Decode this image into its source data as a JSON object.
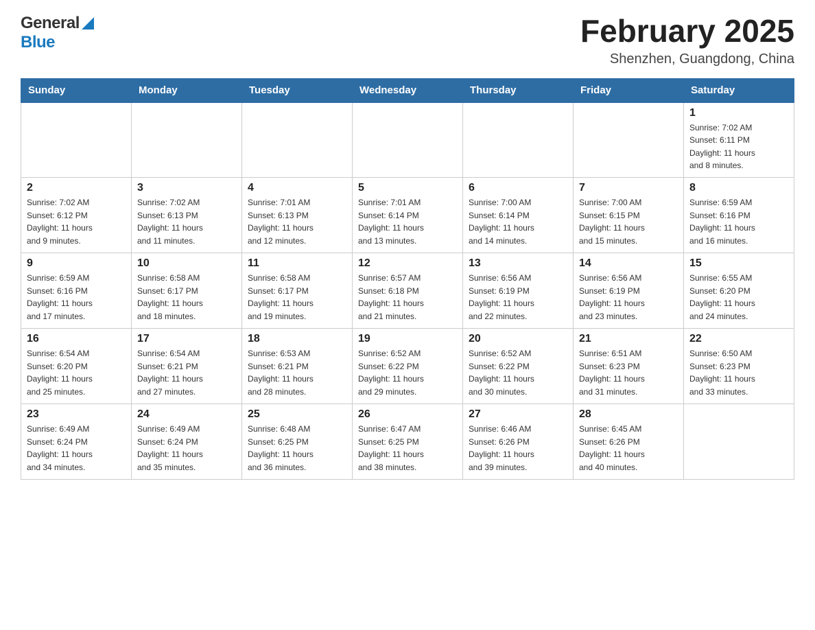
{
  "logo": {
    "general": "General",
    "blue": "Blue"
  },
  "header": {
    "month_year": "February 2025",
    "location": "Shenzhen, Guangdong, China"
  },
  "days_of_week": [
    "Sunday",
    "Monday",
    "Tuesday",
    "Wednesday",
    "Thursday",
    "Friday",
    "Saturday"
  ],
  "weeks": [
    [
      {
        "day": "",
        "info": ""
      },
      {
        "day": "",
        "info": ""
      },
      {
        "day": "",
        "info": ""
      },
      {
        "day": "",
        "info": ""
      },
      {
        "day": "",
        "info": ""
      },
      {
        "day": "",
        "info": ""
      },
      {
        "day": "1",
        "info": "Sunrise: 7:02 AM\nSunset: 6:11 PM\nDaylight: 11 hours\nand 8 minutes."
      }
    ],
    [
      {
        "day": "2",
        "info": "Sunrise: 7:02 AM\nSunset: 6:12 PM\nDaylight: 11 hours\nand 9 minutes."
      },
      {
        "day": "3",
        "info": "Sunrise: 7:02 AM\nSunset: 6:13 PM\nDaylight: 11 hours\nand 11 minutes."
      },
      {
        "day": "4",
        "info": "Sunrise: 7:01 AM\nSunset: 6:13 PM\nDaylight: 11 hours\nand 12 minutes."
      },
      {
        "day": "5",
        "info": "Sunrise: 7:01 AM\nSunset: 6:14 PM\nDaylight: 11 hours\nand 13 minutes."
      },
      {
        "day": "6",
        "info": "Sunrise: 7:00 AM\nSunset: 6:14 PM\nDaylight: 11 hours\nand 14 minutes."
      },
      {
        "day": "7",
        "info": "Sunrise: 7:00 AM\nSunset: 6:15 PM\nDaylight: 11 hours\nand 15 minutes."
      },
      {
        "day": "8",
        "info": "Sunrise: 6:59 AM\nSunset: 6:16 PM\nDaylight: 11 hours\nand 16 minutes."
      }
    ],
    [
      {
        "day": "9",
        "info": "Sunrise: 6:59 AM\nSunset: 6:16 PM\nDaylight: 11 hours\nand 17 minutes."
      },
      {
        "day": "10",
        "info": "Sunrise: 6:58 AM\nSunset: 6:17 PM\nDaylight: 11 hours\nand 18 minutes."
      },
      {
        "day": "11",
        "info": "Sunrise: 6:58 AM\nSunset: 6:17 PM\nDaylight: 11 hours\nand 19 minutes."
      },
      {
        "day": "12",
        "info": "Sunrise: 6:57 AM\nSunset: 6:18 PM\nDaylight: 11 hours\nand 21 minutes."
      },
      {
        "day": "13",
        "info": "Sunrise: 6:56 AM\nSunset: 6:19 PM\nDaylight: 11 hours\nand 22 minutes."
      },
      {
        "day": "14",
        "info": "Sunrise: 6:56 AM\nSunset: 6:19 PM\nDaylight: 11 hours\nand 23 minutes."
      },
      {
        "day": "15",
        "info": "Sunrise: 6:55 AM\nSunset: 6:20 PM\nDaylight: 11 hours\nand 24 minutes."
      }
    ],
    [
      {
        "day": "16",
        "info": "Sunrise: 6:54 AM\nSunset: 6:20 PM\nDaylight: 11 hours\nand 25 minutes."
      },
      {
        "day": "17",
        "info": "Sunrise: 6:54 AM\nSunset: 6:21 PM\nDaylight: 11 hours\nand 27 minutes."
      },
      {
        "day": "18",
        "info": "Sunrise: 6:53 AM\nSunset: 6:21 PM\nDaylight: 11 hours\nand 28 minutes."
      },
      {
        "day": "19",
        "info": "Sunrise: 6:52 AM\nSunset: 6:22 PM\nDaylight: 11 hours\nand 29 minutes."
      },
      {
        "day": "20",
        "info": "Sunrise: 6:52 AM\nSunset: 6:22 PM\nDaylight: 11 hours\nand 30 minutes."
      },
      {
        "day": "21",
        "info": "Sunrise: 6:51 AM\nSunset: 6:23 PM\nDaylight: 11 hours\nand 31 minutes."
      },
      {
        "day": "22",
        "info": "Sunrise: 6:50 AM\nSunset: 6:23 PM\nDaylight: 11 hours\nand 33 minutes."
      }
    ],
    [
      {
        "day": "23",
        "info": "Sunrise: 6:49 AM\nSunset: 6:24 PM\nDaylight: 11 hours\nand 34 minutes."
      },
      {
        "day": "24",
        "info": "Sunrise: 6:49 AM\nSunset: 6:24 PM\nDaylight: 11 hours\nand 35 minutes."
      },
      {
        "day": "25",
        "info": "Sunrise: 6:48 AM\nSunset: 6:25 PM\nDaylight: 11 hours\nand 36 minutes."
      },
      {
        "day": "26",
        "info": "Sunrise: 6:47 AM\nSunset: 6:25 PM\nDaylight: 11 hours\nand 38 minutes."
      },
      {
        "day": "27",
        "info": "Sunrise: 6:46 AM\nSunset: 6:26 PM\nDaylight: 11 hours\nand 39 minutes."
      },
      {
        "day": "28",
        "info": "Sunrise: 6:45 AM\nSunset: 6:26 PM\nDaylight: 11 hours\nand 40 minutes."
      },
      {
        "day": "",
        "info": ""
      }
    ]
  ]
}
